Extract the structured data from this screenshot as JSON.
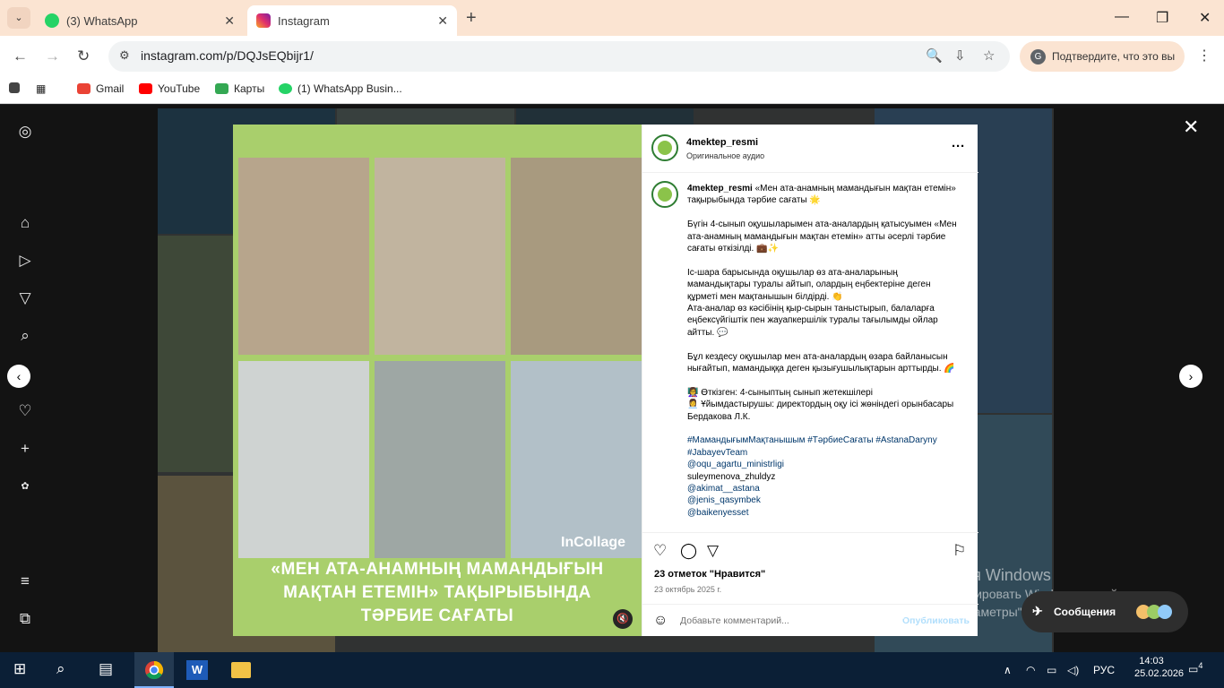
{
  "browser": {
    "tabs": [
      {
        "label": "(3) WhatsApp",
        "icon": "whatsapp-icon",
        "color": "#25d366"
      },
      {
        "label": "Instagram",
        "icon": "instagram-icon",
        "color": "#e1306c"
      }
    ],
    "url": "instagram.com/p/DQJsEQbijr1/",
    "verify_label": "Подтвердите, что это вы",
    "bookmarks": [
      {
        "label": "Gmail",
        "color": "#ea4335"
      },
      {
        "label": "YouTube",
        "color": "#ff0000"
      },
      {
        "label": "Карты",
        "color": "#34a853"
      },
      {
        "label": "(1) WhatsApp Busin...",
        "color": "#25d366"
      }
    ]
  },
  "post": {
    "username": "4mektep_resmi",
    "audio": "Оригинальное аудио",
    "caption_title_line": "«Мен ата-анамның мамандығын мақтан етемін» тақырыбында тәрбие сағаты 🌟",
    "p1": "Бүгін 4-сынып оқушыларымен ата-аналардың қатысуымен «Мен ата-анамның мамандығын мақтан етемін» атты әсерлі тәрбие сағаты өткізілді. 💼✨",
    "p2a": "Іс-шара барысында оқушылар өз ата-аналарының мамандықтары туралы айтып, олардың еңбектеріне деген құрметі мен мақтанышын білдірді. 👏",
    "p2b": "Ата-аналар өз кәсібінің қыр-сырын таныстырып, балаларға еңбексүйгіштік пен жауапкершілік туралы тағылымды ойлар айтты. 💬",
    "p3": "Бұл кездесу оқушылар мен ата-аналардың өзара байланысын нығайтып, мамандыққа деген қызығушылықтарын арттырды. 🌈",
    "p4a": "👩‍🏫 Өткізген: 4-сыныптың сынып жетекшілері",
    "p4b": "👩‍💼 Ұйымдастырушы: директордың оқу ісі жөніндегі орынбасары Бердакова Л.К.",
    "hashtags": "#МамандығымМақтанышым #ТәрбиеСағаты #AstanaDaryny #JabayevTeam",
    "mention1": "@oqu_agartu_ministrligi",
    "mention2": "suleymenova_zhuldyz",
    "mention3": "@akimat__astana",
    "mention4": "@jenis_qasymbek",
    "mention5": "@baikenyesset",
    "likes": "23 отметок \"Нравится\"",
    "date": "23 октябрь 2025 г.",
    "comment_placeholder": "Добавьте комментарий...",
    "publish": "Опубликовать",
    "media_caption": [
      "«МЕН АТА-АНАМНЫҢ МАМАНДЫҒЫН",
      "МАҚТАН ЕТЕМІН» ТАҚЫРЫБЫНДА",
      "ТӘРБИЕ САҒАТЫ"
    ],
    "collage_brand": "InCollage"
  },
  "watermark": {
    "line1": "Активация Windows",
    "line2": "Чтобы активировать Windows, перейдите в",
    "line3": "раздел \"Параметры\"."
  },
  "messages_label": "Сообщения",
  "taskbar": {
    "lang": "РУС",
    "time": "14:03",
    "date": "25.02.2026",
    "notifications": "4"
  },
  "colors": {
    "tabbar_bg": "#fbe4d2",
    "media_bg": "#a9cf6c",
    "taskbar_bg": "#0b1f36",
    "link": "#00376b"
  }
}
